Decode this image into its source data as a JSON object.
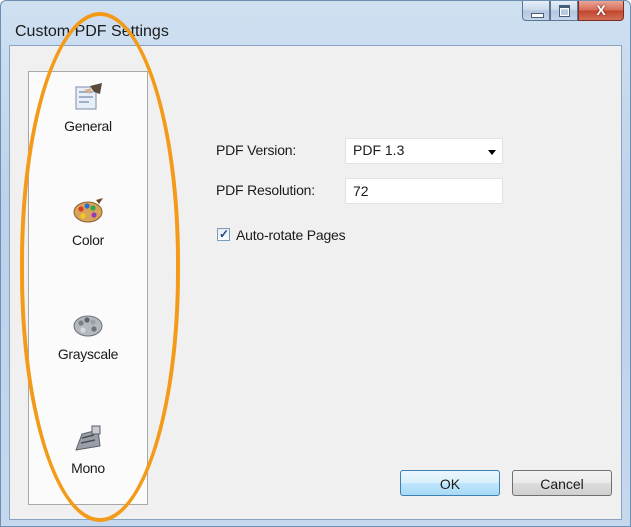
{
  "window": {
    "title": "Custom PDF Settings",
    "caption_buttons": {
      "minimize": "minimize-icon",
      "maximize": "maximize-icon",
      "close": "close-icon",
      "close_glyph": "X"
    }
  },
  "sidebar": {
    "items": [
      {
        "label": "General",
        "icon": "general-settings-icon"
      },
      {
        "label": "Color",
        "icon": "color-palette-icon"
      },
      {
        "label": "Grayscale",
        "icon": "grayscale-palette-icon"
      },
      {
        "label": "Mono",
        "icon": "mono-printer-icon"
      }
    ]
  },
  "form": {
    "pdf_version_label": "PDF Version:",
    "pdf_version_value": "PDF 1.3",
    "pdf_resolution_label": "PDF Resolution:",
    "pdf_resolution_value": "72",
    "auto_rotate_label": "Auto-rotate Pages",
    "auto_rotate_checked": true
  },
  "buttons": {
    "ok": "OK",
    "cancel": "Cancel"
  },
  "colors": {
    "highlight_ellipse": "#f49a19",
    "ok_button_accent": "#3c7fb1",
    "close_button": "#c2452d"
  }
}
